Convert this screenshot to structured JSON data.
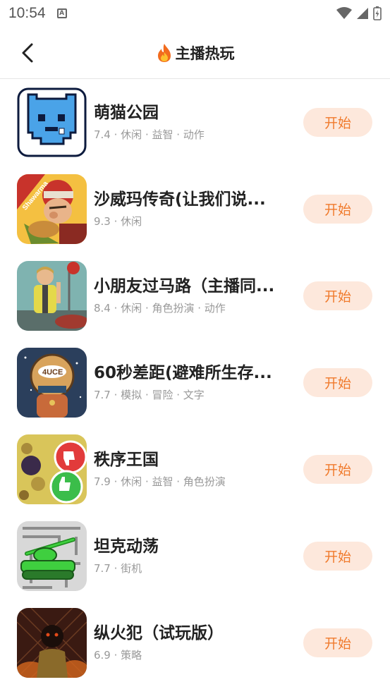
{
  "status_bar": {
    "time": "10:54",
    "notif_letter": "A"
  },
  "header": {
    "title": "主播热玩"
  },
  "games": [
    {
      "name": "萌猫公园",
      "score": "7.4",
      "tags": "休闲 · 益智 · 动作",
      "button": "开始",
      "icon": "cat-park-icon"
    },
    {
      "name": "沙威玛传奇(让我们说...",
      "score": "9.3",
      "tags": "休闲",
      "button": "开始",
      "icon": "shawarma-icon"
    },
    {
      "name": "小朋友过马路（主播同...",
      "score": "8.4",
      "tags": "休闲 · 角色扮演 · 动作",
      "button": "开始",
      "icon": "crossing-guard-icon"
    },
    {
      "name": "60秒差距(避难所生存...",
      "score": "7.7",
      "tags": "模拟 · 冒险 · 文字",
      "button": "开始",
      "icon": "astronaut-icon"
    },
    {
      "name": "秩序王国",
      "score": "7.9",
      "tags": "休闲 · 益智 · 角色扮演",
      "button": "开始",
      "icon": "thumbs-icon"
    },
    {
      "name": "坦克动荡",
      "score": "7.7",
      "tags": "街机",
      "button": "开始",
      "icon": "tank-icon"
    },
    {
      "name": "纵火犯（试玩版）",
      "score": "6.9",
      "tags": "策略",
      "button": "开始",
      "icon": "arsonist-icon"
    }
  ],
  "colors": {
    "accent": "#f07a2c",
    "button_bg": "#fde8dc",
    "meta": "#999999"
  }
}
